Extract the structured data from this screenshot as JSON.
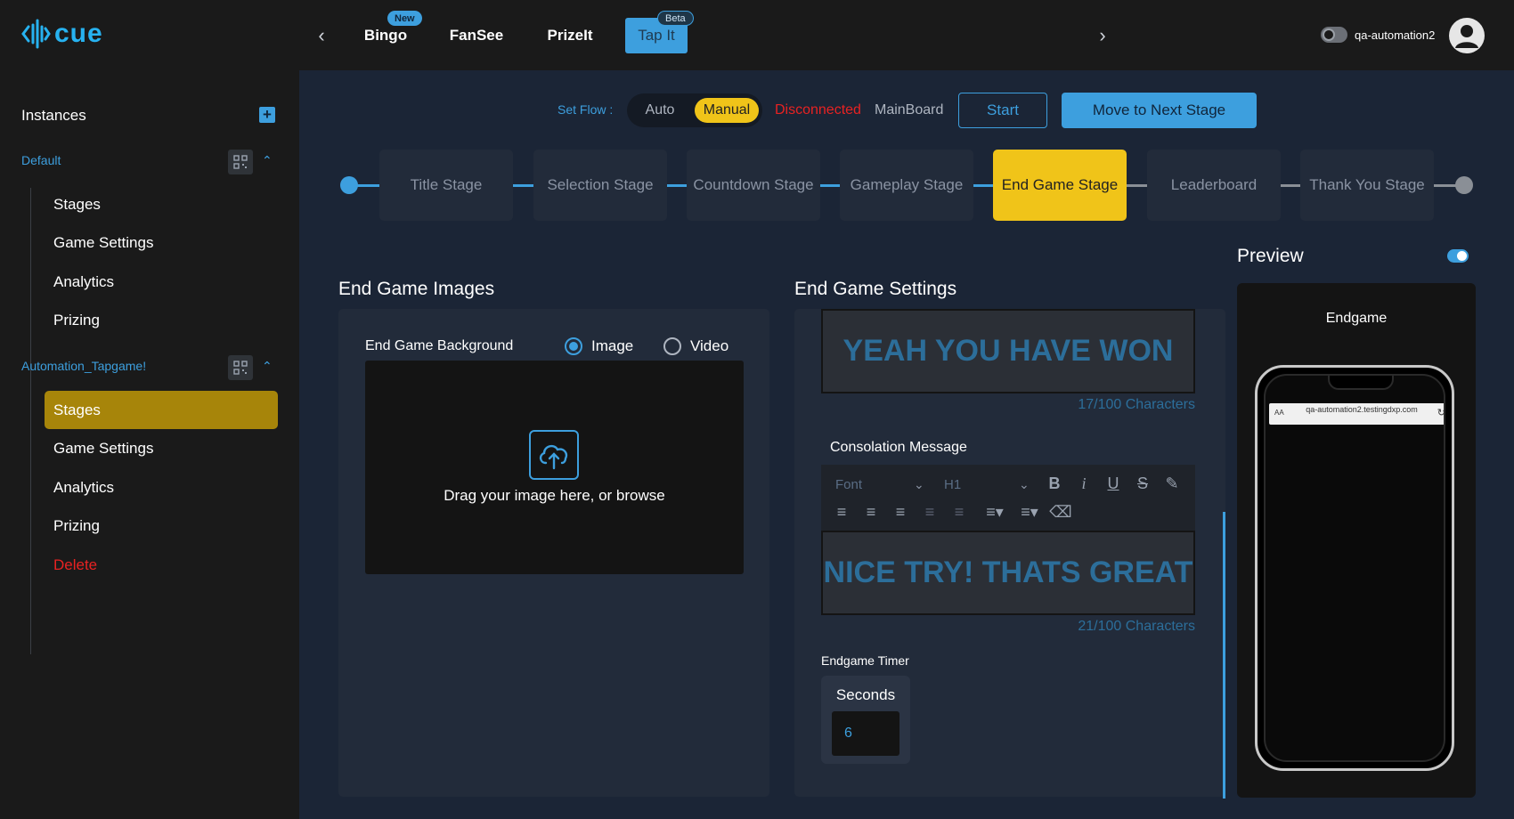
{
  "header": {
    "logo_text": "cue",
    "apps": [
      {
        "label": "Bingo",
        "badge": "New"
      },
      {
        "label": "FanSee",
        "badge": ""
      },
      {
        "label": "PrizeIt",
        "badge": ""
      },
      {
        "label": "Tap It",
        "badge": "Beta"
      }
    ],
    "active_app": "Tap It",
    "username": "qa-automation2"
  },
  "sidebar": {
    "title": "Instances",
    "groups": [
      {
        "name": "Default",
        "items": [
          "Stages",
          "Game Settings",
          "Analytics",
          "Prizing"
        ]
      },
      {
        "name": "Automation_Tapgame!",
        "items": [
          "Stages",
          "Game Settings",
          "Analytics",
          "Prizing",
          "Delete"
        ]
      }
    ],
    "active_item": "Automation_Tapgame!/Stages"
  },
  "flow": {
    "label": "Set Flow :",
    "options": [
      "Auto",
      "Manual"
    ],
    "selected": "Manual",
    "connection_status": "Disconnected",
    "board_name": "MainBoard",
    "start_label": "Start",
    "next_label": "Move to Next Stage"
  },
  "stages": {
    "items": [
      "Title Stage",
      "Selection Stage",
      "Countdown Stage",
      "Gameplay Stage",
      "End Game Stage",
      "Leaderboard",
      "Thank You Stage"
    ],
    "active": "End Game Stage"
  },
  "images_panel": {
    "title": "End Game Images",
    "field_label": "End Game Background",
    "media_options": [
      "Image",
      "Video"
    ],
    "selected_media": "Image",
    "dropzone_text": "Drag your image here, or browse"
  },
  "settings_panel": {
    "title": "End Game Settings",
    "win_message": {
      "text": "YEAH YOU HAVE WON",
      "count": "17/100 Characters"
    },
    "consolation": {
      "label": "Consolation Message",
      "font_placeholder": "Font",
      "heading_value": "H1",
      "text": "NICE TRY! THATS GREAT",
      "count": "21/100 Characters"
    },
    "timer": {
      "label": "Endgame Timer",
      "unit": "Seconds",
      "value": "6"
    }
  },
  "preview": {
    "title": "Preview",
    "enabled": true,
    "screen_label": "Endgame",
    "url_text": "qa-automation2.testingdxp.com",
    "url_aa": "AA"
  },
  "colors": {
    "accent": "#3d9fde",
    "highlight": "#f0c419",
    "active_sidebar": "#a7850a",
    "danger": "#e82222"
  }
}
